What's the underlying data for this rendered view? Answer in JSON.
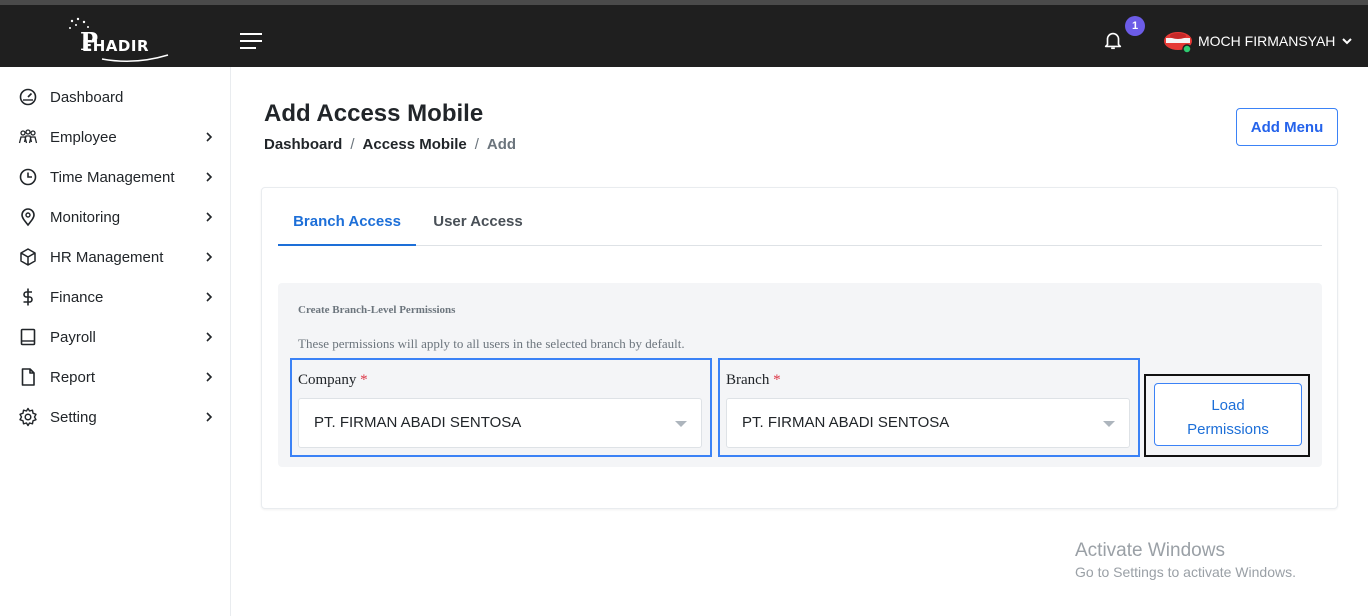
{
  "header": {
    "logo_text": "EHADIR",
    "logo_letter": "P",
    "notification_count": "1",
    "user_name": "MOCH FIRMANSYAH"
  },
  "sidebar": {
    "items": [
      {
        "label": "Dashboard",
        "icon": "gauge-icon",
        "has_children": false
      },
      {
        "label": "Employee",
        "icon": "users-icon",
        "has_children": true
      },
      {
        "label": "Time Management",
        "icon": "clock-icon",
        "has_children": true
      },
      {
        "label": "Monitoring",
        "icon": "map-pin-icon",
        "has_children": true
      },
      {
        "label": "HR Management",
        "icon": "cube-icon",
        "has_children": true
      },
      {
        "label": "Finance",
        "icon": "dollar-icon",
        "has_children": true
      },
      {
        "label": "Payroll",
        "icon": "book-icon",
        "has_children": true
      },
      {
        "label": "Report",
        "icon": "document-icon",
        "has_children": true
      },
      {
        "label": "Setting",
        "icon": "gear-icon",
        "has_children": true
      }
    ]
  },
  "page": {
    "title": "Add Access Mobile",
    "breadcrumb": [
      "Dashboard",
      "Access Mobile",
      "Add"
    ],
    "add_menu_label": "Add Menu"
  },
  "tabs": [
    {
      "label": "Branch Access",
      "active": true
    },
    {
      "label": "User Access",
      "active": false
    }
  ],
  "panel": {
    "title": "Create Branch-Level Permissions",
    "description": "These permissions will apply to all users in the selected branch by default.",
    "company": {
      "label": "Company",
      "required_mark": "*",
      "value": "PT. FIRMAN ABADI SENTOSA"
    },
    "branch": {
      "label": "Branch",
      "required_mark": "*",
      "value": "PT. FIRMAN ABADI SENTOSA"
    },
    "load_button": {
      "line1": "Load",
      "line2": "Permissions"
    }
  },
  "watermark": {
    "title": "Activate Windows",
    "subtitle": "Go to Settings to activate Windows."
  },
  "colors": {
    "topbar": "#1f1f1f",
    "accent": "#1d6fd8",
    "badge": "#6c5ce7",
    "required": "#dc3545"
  }
}
